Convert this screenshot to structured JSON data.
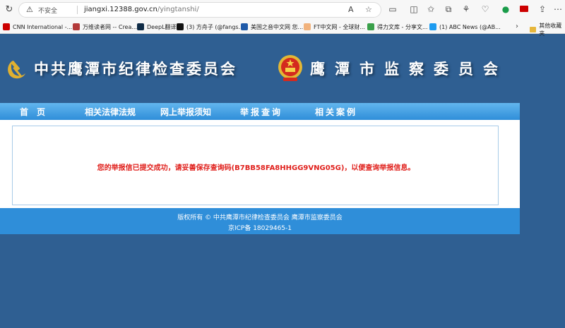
{
  "browser": {
    "insecure_label": "不安全",
    "url_host": "jiangxi.12388.gov.cn",
    "url_path": "/yingtanshi/",
    "read_aloud_label": "A",
    "bookmarks": [
      {
        "label": "CNN International -...",
        "color": "#cc0000"
      },
      {
        "label": "万维读者网 -- Crea...",
        "color": "#b33a3a"
      },
      {
        "label": "DeepL翻译",
        "color": "#0f2b46"
      },
      {
        "label": "(3) 方舟子 (@fangs...",
        "color": "#111111"
      },
      {
        "label": "美国之音中文网 您...",
        "color": "#1f5aa8"
      },
      {
        "label": "FT中文网 - 全球财...",
        "color": "#f1b27c"
      },
      {
        "label": "得力文库 - 分享文...",
        "color": "#3aa04a"
      },
      {
        "label": "(1) ABC News (@AB...",
        "color": "#1d9bf0"
      }
    ],
    "bookmarks_folder": "其他收藏夹"
  },
  "header": {
    "cdi_title": "中共鹰潭市纪律检查委员会",
    "supervision_title": "鹰潭市监察委员会",
    "colors": {
      "party_emblem": "#e0b030",
      "state_emblem_red": "#d42a1e"
    }
  },
  "nav": {
    "items": [
      "首　页",
      "相关法律法规",
      "网上举报须知",
      "举报查询",
      "相关案例"
    ]
  },
  "main": {
    "success_message": "您的举报信已提交成功，请妥善保存查询码(B7BB58FA8HHGG9VNG05G)，以便查询举报信息。",
    "message_color": "#e0201c"
  },
  "footer": {
    "copyright": "版权所有 © 中共鹰潭市纪律检查委员会 鹰潭市监察委员会",
    "icp": "京ICP备 18029465-1"
  }
}
